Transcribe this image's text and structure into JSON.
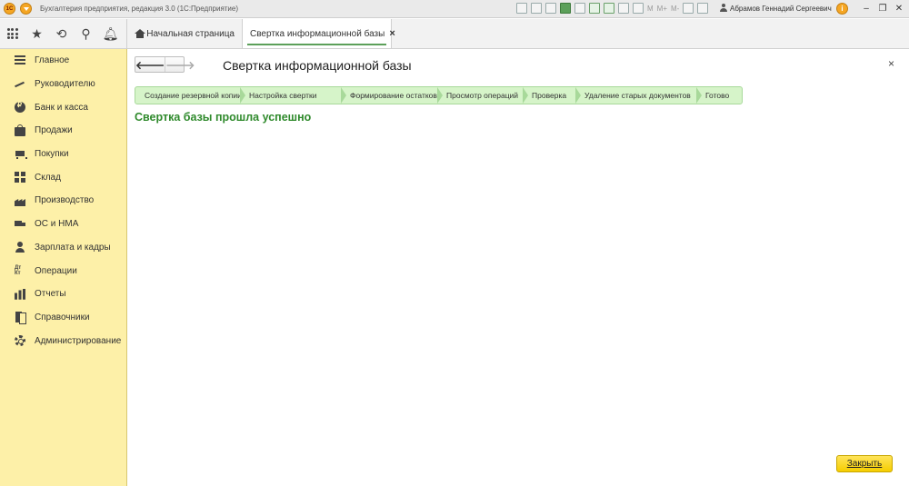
{
  "titlebar": {
    "logo_text": "1С",
    "app_title": "Бухгалтерия предприятия, редакция 3.0  (1С:Предприятие)",
    "m_labels": [
      "M",
      "M+",
      "M-"
    ],
    "user": "Абрамов Геннадий Сергеевич",
    "info_symbol": "i",
    "minimize": "–",
    "restore": "❐",
    "close": "✕"
  },
  "tabs": [
    {
      "label": "Начальная страница"
    },
    {
      "label": "Свертка информационной базы",
      "close": "×"
    }
  ],
  "sidebar": {
    "items": [
      {
        "label": "Главное",
        "icon": "menu-lines-icon"
      },
      {
        "label": "Руководителю",
        "icon": "trend-icon"
      },
      {
        "label": "Банк и касса",
        "icon": "coin-icon"
      },
      {
        "label": "Продажи",
        "icon": "bag-icon"
      },
      {
        "label": "Покупки",
        "icon": "cart-icon"
      },
      {
        "label": "Склад",
        "icon": "boxes-icon"
      },
      {
        "label": "Производство",
        "icon": "factory-icon"
      },
      {
        "label": "ОС и НМА",
        "icon": "truck-icon"
      },
      {
        "label": "Зарплата и кадры",
        "icon": "person-icon"
      },
      {
        "label": "Операции",
        "icon": "dt-kt-icon"
      },
      {
        "label": "Отчеты",
        "icon": "bar-chart-icon"
      },
      {
        "label": "Справочники",
        "icon": "books-icon"
      },
      {
        "label": "Администрирование",
        "icon": "gear-icon"
      }
    ],
    "dtkt": "Дт\nКт"
  },
  "form": {
    "back_arrow": "🡐",
    "forward_arrow": "🡒",
    "title": "Свертка информационной базы",
    "close_symbol": "×",
    "steps": [
      "Создание резервной копии",
      "Настройка свертки",
      "Формирование остатков",
      "Просмотр операций",
      "Проверка",
      "Удаление старых документов",
      "Готово"
    ],
    "success_message": "Свертка базы прошла успешно",
    "close_button": "Закрыть"
  },
  "colors": {
    "sidebar_bg": "#fdf0a8",
    "steps_bg": "#d6f4c9",
    "success_text": "#2f8a2c",
    "close_button_bg": "#f5cd00",
    "accent": "#5ca05a"
  }
}
